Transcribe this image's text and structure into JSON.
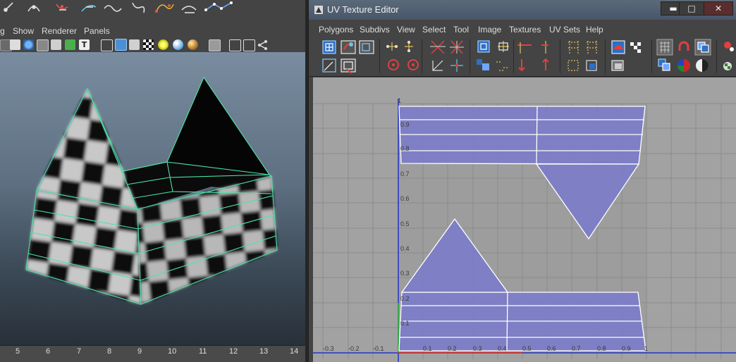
{
  "left_app": {
    "menubar": [
      "g",
      "Show",
      "Renderer",
      "Panels"
    ],
    "ruler_numbers": [
      "5",
      "6",
      "7",
      "8",
      "9",
      "10",
      "11",
      "12",
      "13",
      "14"
    ]
  },
  "uv_editor": {
    "title": "UV Texture Editor",
    "window_controls": {
      "minimize": "▬",
      "maximize": "□",
      "close": "✕"
    },
    "menubar": [
      "Polygons",
      "Subdivs",
      "View",
      "Select",
      "Tool",
      "Image",
      "Textures",
      "UV Sets",
      "Help"
    ],
    "axis_y_labels": [
      "1",
      "0.9",
      "0.8",
      "0.7",
      "0.6",
      "0.5",
      "0.4",
      "0.3",
      "0.2",
      "0.1"
    ],
    "axis_x_labels": [
      "-0.3",
      "-0.2",
      "-0.1",
      "0.1",
      "0.2",
      "0.3",
      "0.4",
      "0.5",
      "0.6",
      "0.7",
      "0.8",
      "0.9",
      "1"
    ]
  },
  "colors": {
    "uv_fill": "#7c7dc6",
    "uv_edge": "#ffffff",
    "grid_line": "#8a8a8a",
    "v_axis": "#2233cc",
    "u_axis": "#2233cc",
    "wire": "#4de3a6"
  }
}
